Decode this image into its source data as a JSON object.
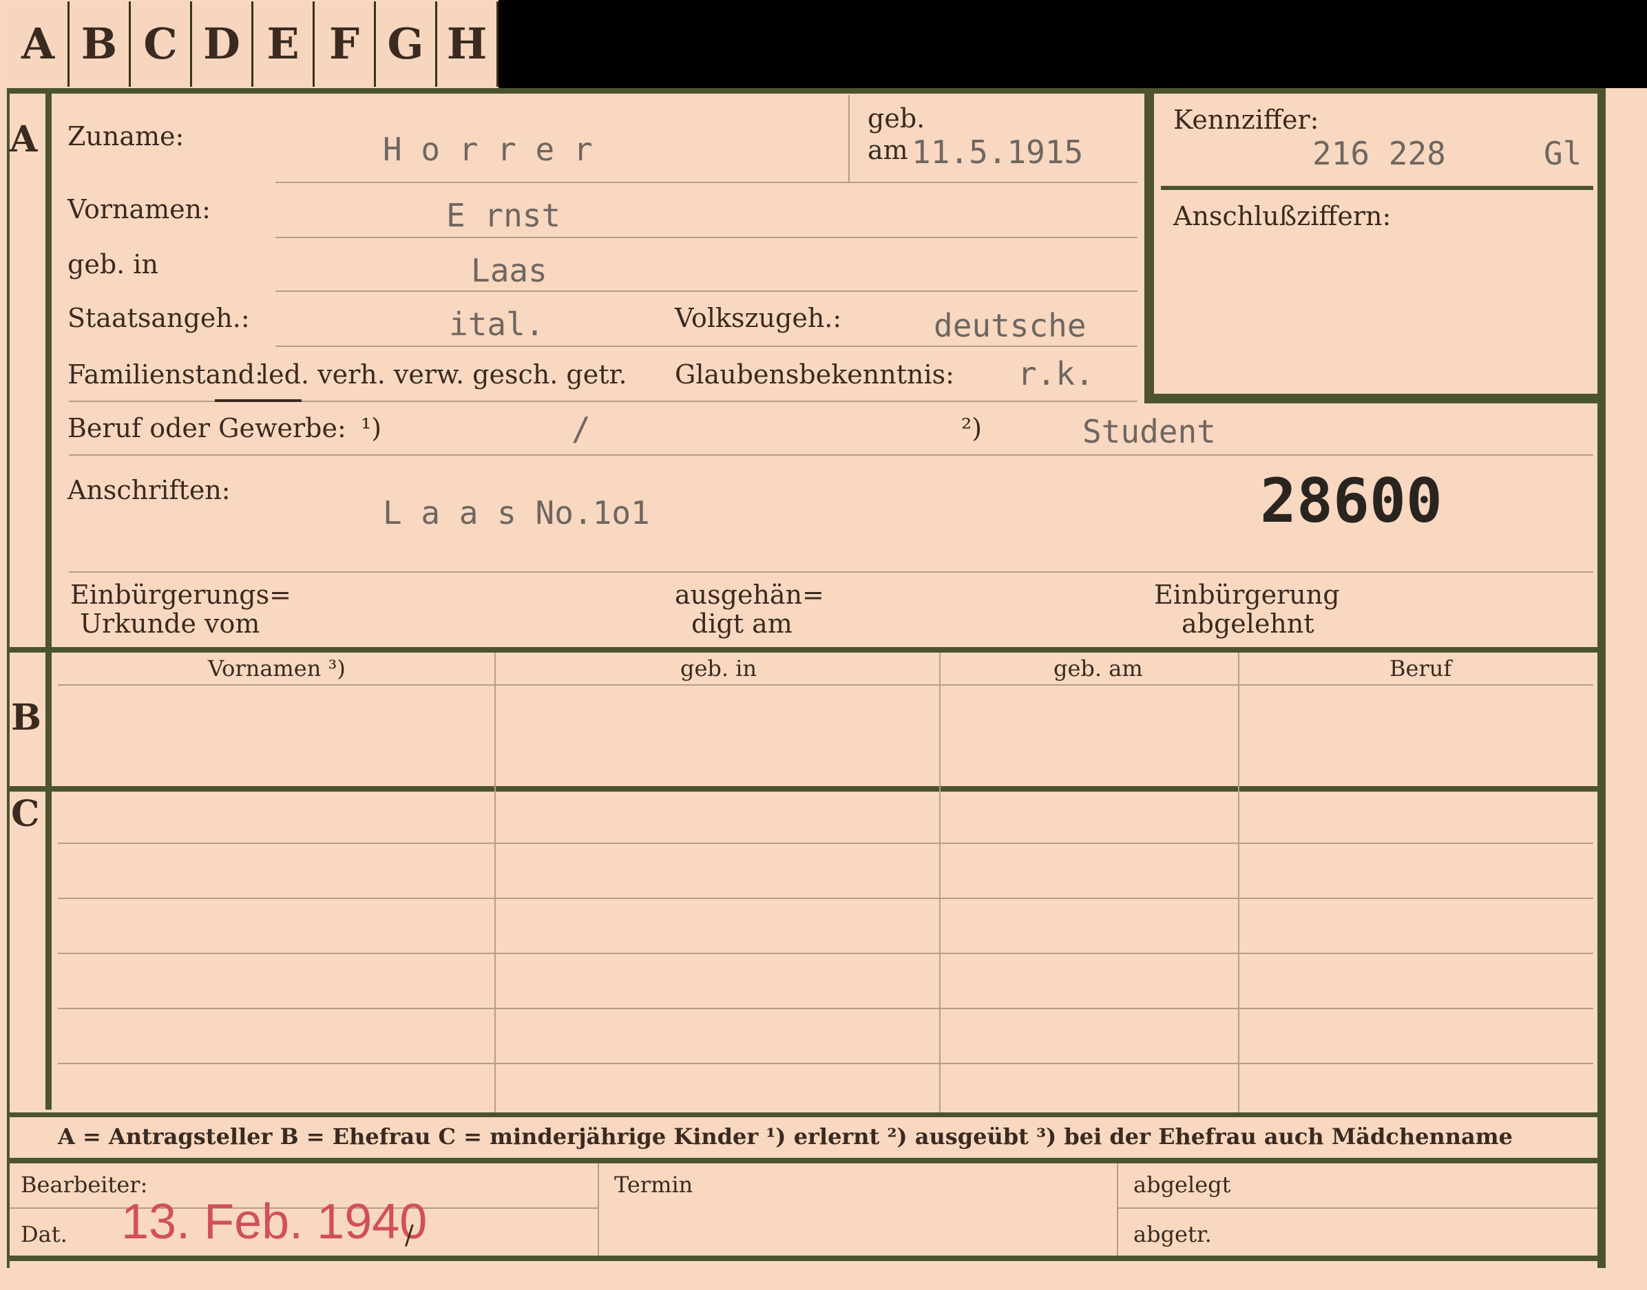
{
  "tabs": [
    "A",
    "B",
    "C",
    "D",
    "E",
    "F",
    "G",
    "H"
  ],
  "section_letters": {
    "a": "A",
    "b": "B",
    "c": "C"
  },
  "labels": {
    "zuname": "Zuname:",
    "geb": "geb.",
    "geb_am": "am",
    "kennziffer": "Kennziffer:",
    "anschlussziffern": "Anschlußziffern:",
    "vornamen": "Vornamen:",
    "geb_in": "geb. in",
    "staatsangeh": "Staatsangeh.:",
    "volkszugeh": "Volkszugeh.:",
    "familienstand": "Familienstand:",
    "familienstand_options": "led. verh. verw. gesch. getr.",
    "glaubensbekenntnis": "Glaubensbekenntnis:",
    "beruf": "Beruf oder Gewerbe:",
    "note1": "¹)",
    "note2": "²)",
    "anschriften": "Anschriften:",
    "einb_urkunde_1": "Einbürgerungs=",
    "einb_urkunde_2": "Urkunde vom",
    "ausgehaen_1": "ausgehän=",
    "ausgehaen_2": "digt am",
    "einb_abgelehnt_1": "Einbürgerung",
    "einb_abgelehnt_2": "abgelehnt"
  },
  "values": {
    "zuname": "H o r r e r",
    "geb_date": "11.5.1915",
    "kennziffer": "216 228",
    "kennziffer_suffix": "Gl",
    "vornamen": "E rnst",
    "geb_in": "Laas",
    "staatsangeh": "ital.",
    "volkszugeh": "deutsche",
    "glaubensbekenntnis": "r.k.",
    "beruf_1": "/",
    "beruf_2": "Student",
    "anschrift": "L a a s No.1o1",
    "number": "28600"
  },
  "table_b": {
    "headers": [
      "Vornamen ³)",
      "geb. in",
      "geb. am",
      "Beruf"
    ]
  },
  "legend": "A = Antragsteller   B = Ehefrau   C = minderjährige Kinder   ¹) erlernt   ²) ausgeübt   ³) bei der Ehefrau auch Mädchenname",
  "footer": {
    "bearbeiter": "Bearbeiter:",
    "dat": "Dat.",
    "stamp": "13. Feb. 1940",
    "slash": "/",
    "termin": "Termin",
    "abgelegt": "abgelegt",
    "abgetr": "abgetr."
  },
  "colors": {
    "paper": "#f8d8c0",
    "rule": "#4b5330",
    "stamp": "#d0505a"
  }
}
